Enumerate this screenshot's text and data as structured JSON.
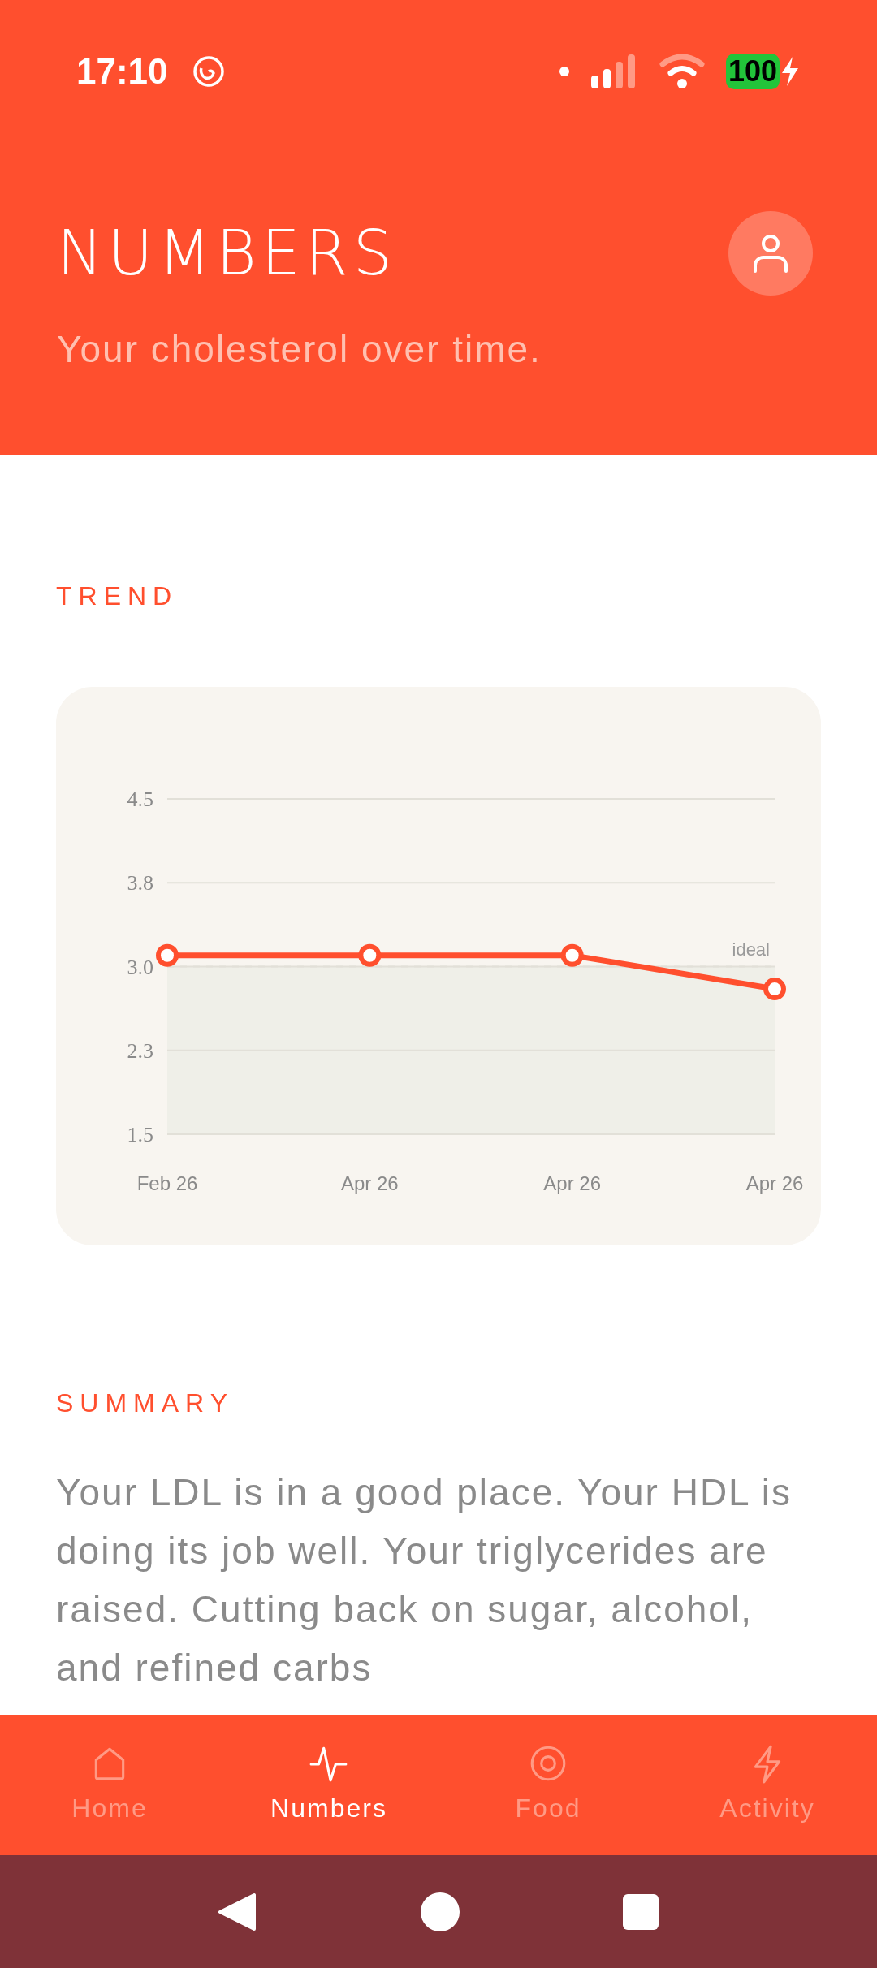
{
  "status_bar": {
    "time": "17:10",
    "battery": "100"
  },
  "header": {
    "title": "NUMBERS",
    "subtitle": "Your cholesterol over time."
  },
  "trend": {
    "label": "TREND",
    "chart_data": {
      "type": "line",
      "categories": [
        "Feb 26",
        "Apr 26",
        "Apr 26",
        "Apr 26"
      ],
      "series": [
        {
          "color": "#ff4f2e",
          "marker": "o",
          "values": [
            3.1,
            3.1,
            3.1,
            2.8
          ]
        }
      ],
      "grid": true,
      "ylim": [
        1.5,
        4.5
      ],
      "yticks": [
        {
          "value": 1.5,
          "label": "1.5"
        },
        {
          "value": 2.25,
          "label": "2.3"
        },
        {
          "value": 3.0,
          "label": "3.0"
        },
        {
          "value": 3.75,
          "label": "3.8"
        },
        {
          "value": 4.5,
          "label": "4.5"
        }
      ],
      "bands": [
        {
          "axis": "y",
          "from": 1.5,
          "to": 3.0
        }
      ],
      "ref_lines": [
        {
          "axis": "y",
          "value": 3.0,
          "label": "ideal"
        }
      ]
    }
  },
  "summary": {
    "label": "SUMMARY",
    "text": "Your LDL is in a good place. Your HDL is doing its job well. Your triglycerides are raised. Cutting back on sugar, alcohol, and refined carbs"
  },
  "tabs": [
    {
      "label": "Home",
      "selected": false
    },
    {
      "label": "Numbers",
      "selected": true
    },
    {
      "label": "Food",
      "selected": false
    },
    {
      "label": "Activity",
      "selected": false
    }
  ]
}
